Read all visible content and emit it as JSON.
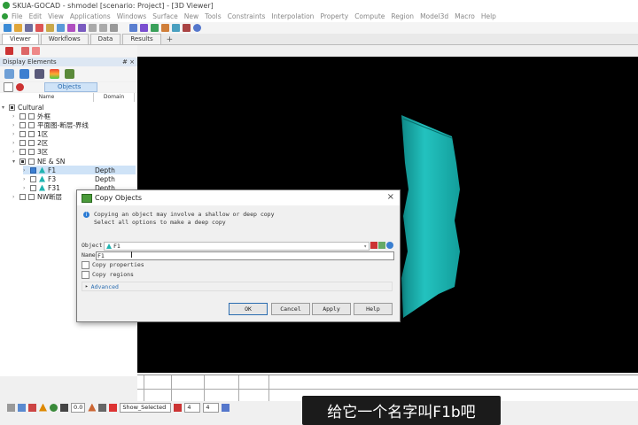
{
  "app": {
    "title": "SKUA-GOCAD - shmodel [scenario: Project] - [3D Viewer]"
  },
  "menu": [
    "File",
    "Edit",
    "View",
    "Applications",
    "Windows",
    "Surface",
    "New",
    "Tools",
    "Constraints",
    "Interpolation",
    "Property",
    "Compute",
    "Region",
    "Model3d",
    "Macro",
    "Help"
  ],
  "tabs": [
    "Viewer",
    "Workflows",
    "Data",
    "Results",
    "+"
  ],
  "panel": {
    "header": "Display Elements",
    "header_icons": "# ×",
    "objects_tab": "Objects",
    "columns": [
      "Name",
      "Domain"
    ]
  },
  "tree": [
    {
      "label": "Cultural",
      "domain": "",
      "level": 0
    },
    {
      "label": "外框",
      "domain": "",
      "level": 1
    },
    {
      "label": "平面图-断层-界线",
      "domain": "",
      "level": 1
    },
    {
      "label": "1区",
      "domain": "",
      "level": 1
    },
    {
      "label": "2区",
      "domain": "",
      "level": 1
    },
    {
      "label": "3区",
      "domain": "",
      "level": 1
    },
    {
      "label": "NE & SN",
      "domain": "",
      "level": 1
    },
    {
      "label": "F1",
      "domain": "Depth",
      "level": 2
    },
    {
      "label": "F3",
      "domain": "Depth",
      "level": 2
    },
    {
      "label": "F31",
      "domain": "Depth",
      "level": 2
    },
    {
      "label": "NW断层",
      "domain": "",
      "level": 1
    }
  ],
  "dialog": {
    "title": "Copy Objects",
    "close": "×",
    "message_line1": "Copying an object may involve a shallow or deep copy",
    "message_line2": "Select all options to make a deep copy",
    "object_label": "Object",
    "object_value": "F1",
    "name_label": "Name",
    "name_value": "F1",
    "copy_properties": "Copy properties",
    "copy_regions": "Copy regions",
    "advanced": "Advanced",
    "buttons": {
      "ok": "OK",
      "cancel": "Cancel",
      "apply": "Apply",
      "help": "Help"
    }
  },
  "statusbar": {
    "zoom": "0.0",
    "mode": "Show_Selected",
    "field_a": "4",
    "field_b": "4"
  },
  "subtitle": "给它一个名字叫F1b吧",
  "colors": {
    "surface": "#1fb3b0",
    "accent": "#2a6cb0",
    "viewer_bg": "#000000"
  }
}
